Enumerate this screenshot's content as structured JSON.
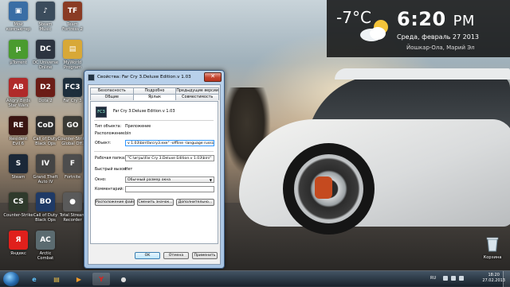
{
  "desktop": {
    "icons": [
      {
        "label": "Мой\nкомпьютер",
        "name": "my-computer-icon",
        "color": "#3a6ea5",
        "glyph": "▣"
      },
      {
        "label": "Steam\nMusic",
        "name": "steam-music-icon",
        "color": "#3b4c5c",
        "glyph": "♪"
      },
      {
        "label": "Team\nFortress 2",
        "name": "team-fortress-icon",
        "color": "#8a3b24",
        "glyph": "TF"
      },
      {
        "label": "µTorrent",
        "name": "utorrent-icon",
        "color": "#4a9b2f",
        "glyph": "µ"
      },
      {
        "label": "DC Universe\nOnline",
        "name": "dcuo-icon",
        "color": "#2c3440",
        "glyph": "DC"
      },
      {
        "label": "MyWorld\nProgram",
        "name": "folder-icon",
        "color": "#d8a837",
        "glyph": "▤"
      },
      {
        "label": "Angry Birds\nStar Wars",
        "name": "angry-birds-icon",
        "color": "#b02a2a",
        "glyph": "AB"
      },
      {
        "label": "Dota 2",
        "name": "dota2-icon",
        "color": "#6b1d16",
        "glyph": "D2"
      },
      {
        "label": "Far Cry 3",
        "name": "far-cry-3-icon",
        "color": "#1d2e3c",
        "glyph": "FC3"
      },
      {
        "label": "Resident\nEvil 6",
        "name": "resident-evil-icon",
        "color": "#3a1512",
        "glyph": "RE"
      },
      {
        "label": "Call of Duty\nBlack Ops",
        "name": "cod-black-ops-icon",
        "color": "#2f2f2f",
        "glyph": "CoD"
      },
      {
        "label": "Counter-Strike\nGlobal Off.",
        "name": "csgo-icon",
        "color": "#3b3b36",
        "glyph": "GO"
      },
      {
        "label": "Steam",
        "name": "steam-icon",
        "color": "#1b2838",
        "glyph": "S"
      },
      {
        "label": "Grand Theft\nAuto IV",
        "name": "gta4-icon",
        "color": "#444",
        "glyph": "IV"
      },
      {
        "label": "Fortnite",
        "name": "fortnite-icon",
        "color": "#4d4d4d",
        "glyph": "F"
      },
      {
        "label": "Counter-Strike",
        "name": "counter-strike-icon",
        "color": "#2f3a2c",
        "glyph": "CS"
      },
      {
        "label": "Call of Duty\nBlack Ops",
        "name": "cod-icon-2",
        "color": "#1f3a66",
        "glyph": "BO"
      },
      {
        "label": "Total Stream\nRecorder",
        "name": "recorder-icon",
        "color": "#5a5a5a",
        "glyph": "●"
      },
      {
        "label": "Яндекс",
        "name": "yandex-icon",
        "color": "#e0201c",
        "glyph": "Я"
      },
      {
        "label": "Arctic\nCombat",
        "name": "arctic-combat-icon",
        "color": "#5b6b70",
        "glyph": "AC"
      }
    ],
    "recycle_bin": {
      "label": "Корзина"
    }
  },
  "gadget": {
    "temperature": "-7°C",
    "time": "6:20",
    "ampm": "PM",
    "date": "Среда, февраль 27 2013",
    "city": "Йошкар-Ола, Марий Эл"
  },
  "dialog": {
    "title": "Свойства: Far Cry 3.Deluxe Edition.v 1.03",
    "close_label": "✕",
    "tabs_row1": [
      "Безопасность",
      "Подробно",
      "Предыдущие версии"
    ],
    "tabs_row2": [
      "Общие",
      "Ярлык",
      "Совместимость"
    ],
    "shortcut_name": "Far Cry 3.Deluxe Edition.v 1.03",
    "shortcut_icon_text": "FC3",
    "labels": {
      "type": "Тип объекта:",
      "location": "Расположение:",
      "object": "Объект:",
      "workdir": "Рабочая папка:",
      "hotkey": "Быстрый вызов:",
      "window": "Окно:",
      "comment": "Комментарий:"
    },
    "values": {
      "type": "Приложение",
      "location": "bin",
      "object": "v 1.03\\bin\\farcry3.exe\" -offline -language russian",
      "workdir": "\"C:\\игры\\Far Cry 3.Deluxe Edition.v 1.03\\bin\\\"",
      "hotkey": "Нет",
      "window": "Обычный размер окна",
      "comment": ""
    },
    "buttons": {
      "open_location": "Расположение файла",
      "change_icon": "Сменить значок...",
      "advanced": "Дополнительно...",
      "ok": "OK",
      "cancel": "Отмена",
      "apply": "Применить"
    }
  },
  "taskbar": {
    "lang": "RU",
    "time": "18:20",
    "date": "27.02.2013"
  }
}
